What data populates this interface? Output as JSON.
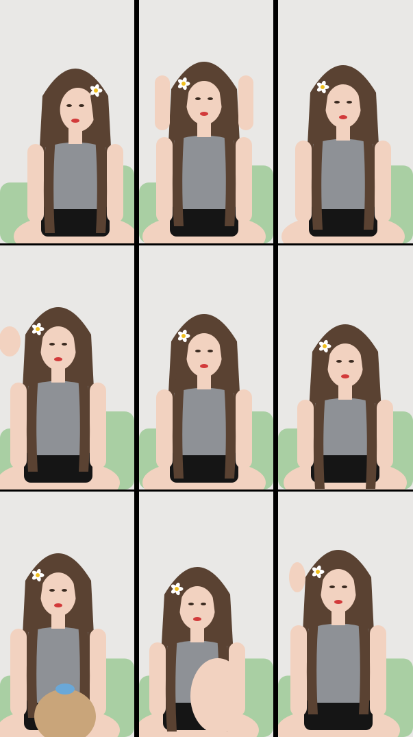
{
  "collage": {
    "frames": [
      {
        "id": 1,
        "pose": "head-turned-right",
        "flower_side": "right"
      },
      {
        "id": 2,
        "pose": "hands-on-head",
        "flower_side": "left"
      },
      {
        "id": 3,
        "pose": "smiling-seated",
        "flower_side": "left"
      },
      {
        "id": 4,
        "pose": "waving-hand",
        "flower_side": "left"
      },
      {
        "id": 5,
        "pose": "seated-center",
        "flower_side": "left"
      },
      {
        "id": 6,
        "pose": "seated-center",
        "flower_side": "left"
      },
      {
        "id": 7,
        "pose": "holding-plush-toy",
        "flower_side": "left"
      },
      {
        "id": 8,
        "pose": "knee-raised-smiling",
        "flower_side": "left"
      },
      {
        "id": 9,
        "pose": "hand-near-head",
        "flower_side": "left"
      }
    ],
    "colors": {
      "wall": "#e9e8e6",
      "sofa": "#a9cfa3",
      "hair": "#5a4232",
      "skin": "#f2d2c0",
      "top": "#8e9196",
      "shorts": "#151515",
      "flower": "#ffffff",
      "flower_center": "#f0c020"
    }
  }
}
